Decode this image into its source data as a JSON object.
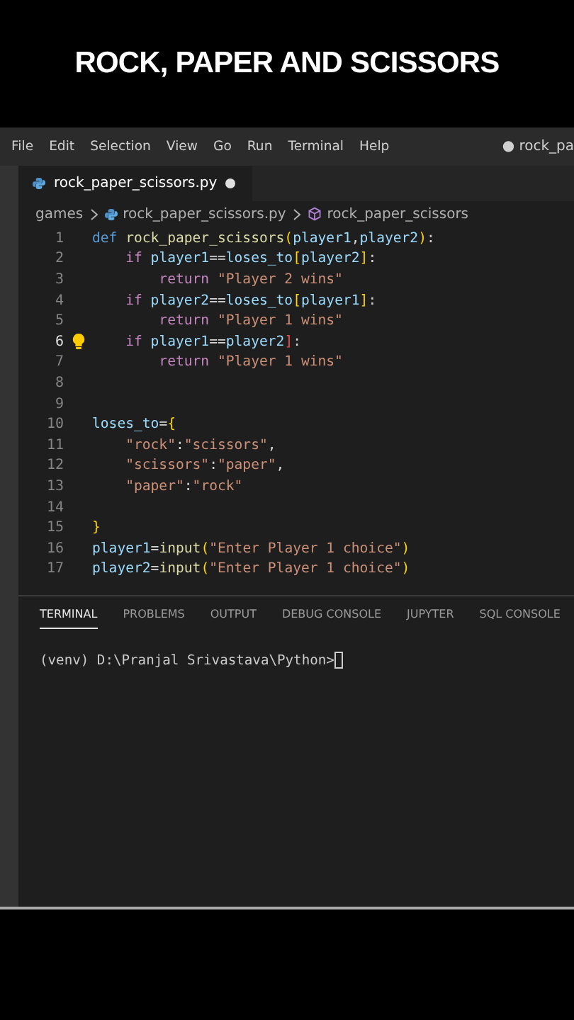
{
  "banner": {
    "title": "ROCK, PAPER AND SCISSORS"
  },
  "menu": {
    "items": [
      "File",
      "Edit",
      "Selection",
      "View",
      "Go",
      "Run",
      "Terminal",
      "Help"
    ],
    "window_title": "● rock_pa"
  },
  "editor_tab": {
    "label": "rock_paper_scissors.py",
    "modified": true,
    "selected": true
  },
  "breadcrumb": [
    {
      "label": "games",
      "kind": "folder"
    },
    {
      "label": "rock_paper_scissors.py",
      "kind": "file"
    },
    {
      "label": "rock_paper_scissors",
      "kind": "symbol"
    }
  ],
  "code": [
    {
      "number": "1",
      "active": false,
      "lightbulb": false,
      "tokens": [
        {
          "text": "def ",
          "kind": "keyword"
        },
        {
          "text": "rock_paper_scissors",
          "kind": "function"
        },
        {
          "text": "(",
          "kind": "bracket"
        },
        {
          "text": "player1",
          "kind": "variable"
        },
        {
          "text": ",",
          "kind": "plain"
        },
        {
          "text": "player2",
          "kind": "variable"
        },
        {
          "text": ")",
          "kind": "bracket"
        },
        {
          "text": ":",
          "kind": "plain"
        }
      ]
    },
    {
      "number": "2",
      "active": false,
      "lightbulb": false,
      "tokens": [
        {
          "text": "    if ",
          "kind": "control"
        },
        {
          "text": "player1",
          "kind": "variable"
        },
        {
          "text": "==",
          "kind": "plain"
        },
        {
          "text": "loses_to",
          "kind": "variable"
        },
        {
          "text": "[",
          "kind": "bracket"
        },
        {
          "text": "player2",
          "kind": "variable"
        },
        {
          "text": "]",
          "kind": "bracket"
        },
        {
          "text": ":",
          "kind": "plain"
        }
      ]
    },
    {
      "number": "3",
      "active": false,
      "lightbulb": false,
      "tokens": [
        {
          "text": "        return ",
          "kind": "control"
        },
        {
          "text": "\"Player 2 wins\"",
          "kind": "string"
        }
      ]
    },
    {
      "number": "4",
      "active": false,
      "lightbulb": false,
      "tokens": [
        {
          "text": "    if ",
          "kind": "control"
        },
        {
          "text": "player2",
          "kind": "variable"
        },
        {
          "text": "==",
          "kind": "plain"
        },
        {
          "text": "loses_to",
          "kind": "variable"
        },
        {
          "text": "[",
          "kind": "bracket"
        },
        {
          "text": "player1",
          "kind": "variable"
        },
        {
          "text": "]",
          "kind": "bracket"
        },
        {
          "text": ":",
          "kind": "plain"
        }
      ]
    },
    {
      "number": "5",
      "active": false,
      "lightbulb": false,
      "tokens": [
        {
          "text": "        return ",
          "kind": "control"
        },
        {
          "text": "\"Player 1 wins\"",
          "kind": "string"
        }
      ]
    },
    {
      "number": "6",
      "active": true,
      "lightbulb": true,
      "tokens": [
        {
          "text": "    if ",
          "kind": "control"
        },
        {
          "text": "player1",
          "kind": "variable"
        },
        {
          "text": "==",
          "kind": "plain"
        },
        {
          "text": "player2",
          "kind": "variable"
        },
        {
          "text": "]",
          "kind": "error"
        },
        {
          "text": ":",
          "kind": "plain"
        }
      ]
    },
    {
      "number": "7",
      "active": false,
      "lightbulb": false,
      "tokens": [
        {
          "text": "        return ",
          "kind": "control"
        },
        {
          "text": "\"Player 1 wins\"",
          "kind": "string"
        }
      ]
    },
    {
      "number": "8",
      "active": false,
      "lightbulb": false
    },
    {
      "number": "9",
      "active": false,
      "lightbulb": false
    },
    {
      "number": "10",
      "active": false,
      "lightbulb": false,
      "tokens": [
        {
          "text": "loses_to",
          "kind": "variable"
        },
        {
          "text": "=",
          "kind": "plain"
        },
        {
          "text": "{",
          "kind": "bracket"
        }
      ]
    },
    {
      "number": "11",
      "active": false,
      "lightbulb": false,
      "tokens": [
        {
          "text": "    \"rock\"",
          "kind": "string"
        },
        {
          "text": ":",
          "kind": "plain"
        },
        {
          "text": "\"scissors\"",
          "kind": "string"
        },
        {
          "text": ",",
          "kind": "plain"
        }
      ]
    },
    {
      "number": "12",
      "active": false,
      "lightbulb": false,
      "tokens": [
        {
          "text": "    \"scissors\"",
          "kind": "string"
        },
        {
          "text": ":",
          "kind": "plain"
        },
        {
          "text": "\"paper\"",
          "kind": "string"
        },
        {
          "text": ",",
          "kind": "plain"
        }
      ]
    },
    {
      "number": "13",
      "active": false,
      "lightbulb": false,
      "tokens": [
        {
          "text": "    \"paper\"",
          "kind": "string"
        },
        {
          "text": ":",
          "kind": "plain"
        },
        {
          "text": "\"rock\"",
          "kind": "string"
        }
      ]
    },
    {
      "number": "14",
      "active": false,
      "lightbulb": false
    },
    {
      "number": "15",
      "active": false,
      "lightbulb": false,
      "tokens": [
        {
          "text": "}",
          "kind": "bracket"
        }
      ]
    },
    {
      "number": "16",
      "active": false,
      "lightbulb": false,
      "tokens": [
        {
          "text": "player1",
          "kind": "variable"
        },
        {
          "text": "=",
          "kind": "plain"
        },
        {
          "text": "input",
          "kind": "function"
        },
        {
          "text": "(",
          "kind": "bracket"
        },
        {
          "text": "\"Enter Player 1 choice\"",
          "kind": "string"
        },
        {
          "text": ")",
          "kind": "bracket"
        }
      ]
    },
    {
      "number": "17",
      "active": false,
      "lightbulb": false,
      "tokens": [
        {
          "text": "player2",
          "kind": "variable"
        },
        {
          "text": "=",
          "kind": "plain"
        },
        {
          "text": "input",
          "kind": "function"
        },
        {
          "text": "(",
          "kind": "bracket"
        },
        {
          "text": "\"Enter Player 1 choice\"",
          "kind": "string"
        },
        {
          "text": ")",
          "kind": "bracket"
        }
      ]
    }
  ],
  "panel_tabs": [
    {
      "label": "TERMINAL",
      "selected": true
    },
    {
      "label": "PROBLEMS",
      "selected": false
    },
    {
      "label": "OUTPUT",
      "selected": false
    },
    {
      "label": "DEBUG CONSOLE",
      "selected": false
    },
    {
      "label": "JUPYTER",
      "selected": false
    },
    {
      "label": "SQL CONSOLE",
      "selected": false
    }
  ],
  "terminal": {
    "prompt": "(venv) D:\\Pranjal Srivastava\\Python>"
  }
}
